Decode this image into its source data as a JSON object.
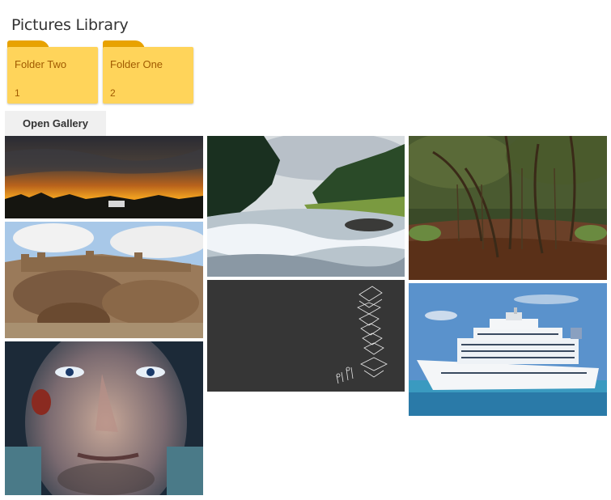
{
  "library": {
    "title": "Pictures Library"
  },
  "folders": [
    {
      "name": "Folder Two",
      "count": "1"
    },
    {
      "name": "Folder One",
      "count": "2"
    }
  ],
  "gallery": {
    "open_label": "Open Gallery"
  },
  "colors": {
    "folder_tab": "#e8a200",
    "folder_body": "#ffd45a",
    "folder_text": "#a05a00"
  }
}
